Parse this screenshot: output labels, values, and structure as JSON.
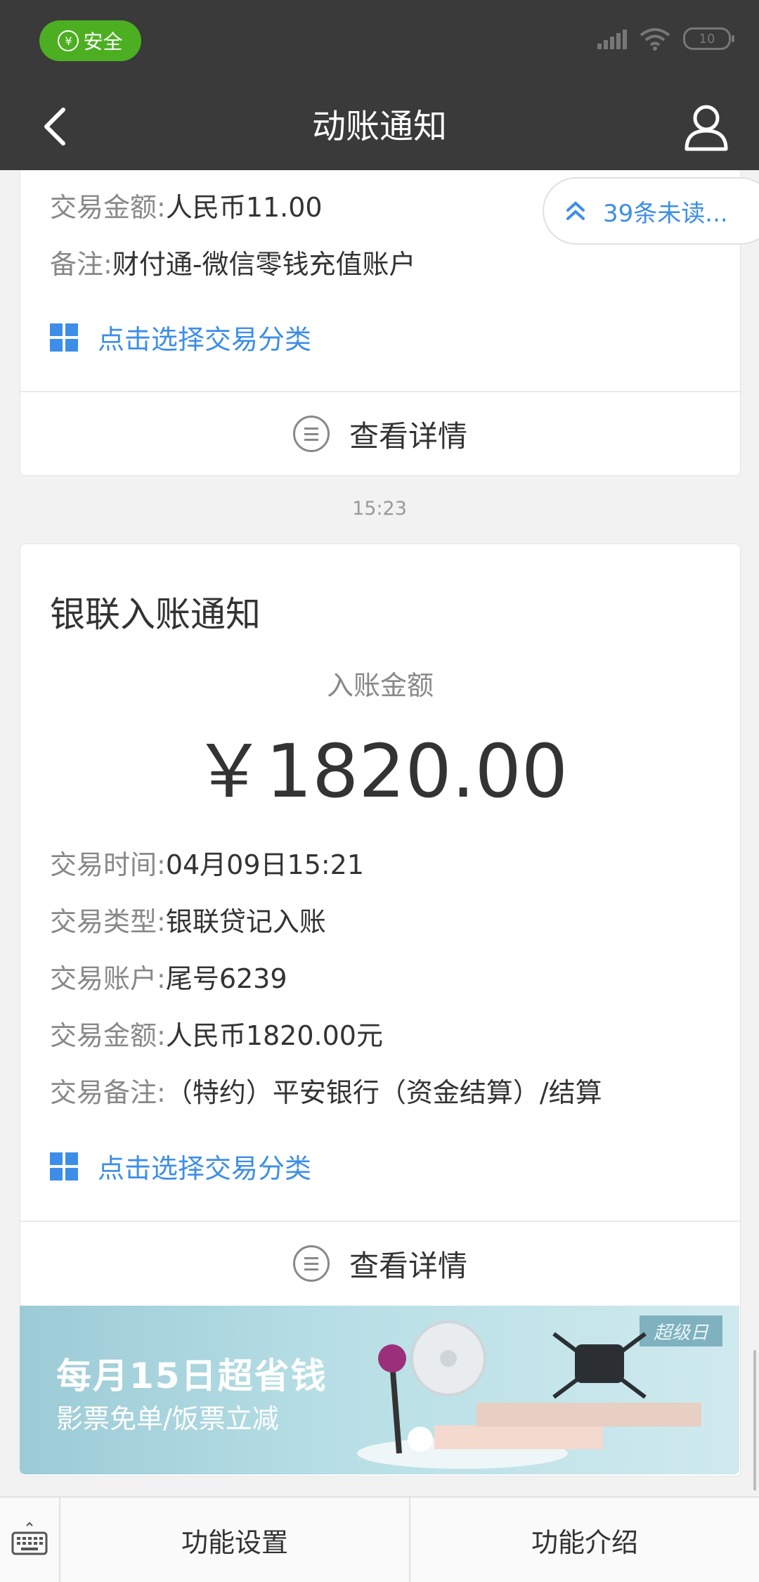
{
  "status_bar": {
    "secure_label": "安全",
    "secure_symbol": "¥",
    "battery": "10"
  },
  "nav": {
    "title": "动账通知"
  },
  "unread": {
    "label": "39条未读..."
  },
  "card1": {
    "rows": [
      {
        "key": "交易金额:",
        "value": "人民币11.00"
      },
      {
        "key": "备注:",
        "value": "财付通-微信零钱充值账户"
      }
    ],
    "category_link": "点击选择交易分类",
    "details_label": "查看详情"
  },
  "timestamp": "15:23",
  "card2": {
    "title": "银联入账通知",
    "amount_label": "入账金额",
    "amount": "￥1820.00",
    "rows": [
      {
        "key": "交易时间:",
        "value": "04月09日15:21"
      },
      {
        "key": "交易类型:",
        "value": "银联贷记入账"
      },
      {
        "key": "交易账户:",
        "value": "尾号6239"
      },
      {
        "key": "交易金额:",
        "value": "人民币1820.00元"
      },
      {
        "key": "交易备注:",
        "value": "（特约）平安银行（资金结算）/结算"
      }
    ],
    "category_link": "点击选择交易分类",
    "details_label": "查看详情"
  },
  "banner": {
    "title": "每月15日超省钱",
    "subtitle": "影票免单/饭票立减",
    "tag": "超级日"
  },
  "bottom_bar": {
    "items": [
      "功能设置",
      "功能介绍"
    ]
  },
  "colors": {
    "accent": "#3d8ee8",
    "header_bg": "#3a3a3a",
    "secure_green": "#4caf22"
  }
}
